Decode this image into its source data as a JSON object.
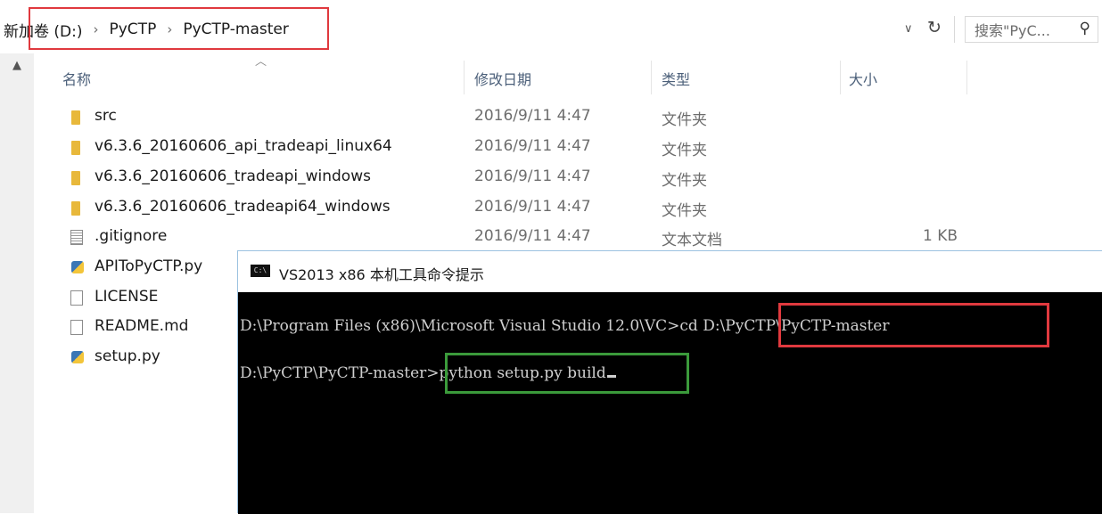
{
  "address_bar": {
    "crumbs": [
      "新加卷 (D:)",
      "PyCTP",
      "PyCTP-master"
    ],
    "separator": "›",
    "search_placeholder": "搜索\"PyC...",
    "refresh_glyph": "↻",
    "dropdown_glyph": "∨",
    "search_glyph": "⚲"
  },
  "columns": {
    "name": "名称",
    "modified": "修改日期",
    "type": "类型",
    "size": "大小"
  },
  "files": [
    {
      "name": "src",
      "modified": "2016/9/11 4:47",
      "type": "文件夹",
      "size": "",
      "icon": "folder-icon"
    },
    {
      "name": "v6.3.6_20160606_api_tradeapi_linux64",
      "modified": "2016/9/11 4:47",
      "type": "文件夹",
      "size": "",
      "icon": "folder-icon"
    },
    {
      "name": "v6.3.6_20160606_tradeapi_windows",
      "modified": "2016/9/11 4:47",
      "type": "文件夹",
      "size": "",
      "icon": "folder-icon"
    },
    {
      "name": "v6.3.6_20160606_tradeapi64_windows",
      "modified": "2016/9/11 4:47",
      "type": "文件夹",
      "size": "",
      "icon": "folder-icon"
    },
    {
      "name": ".gitignore",
      "modified": "2016/9/11 4:47",
      "type": "文本文档",
      "size": "1 KB",
      "icon": "text-file-icon"
    },
    {
      "name": "APIToPyCTP.py",
      "modified": "",
      "type": "",
      "size": "",
      "icon": "python-file-icon"
    },
    {
      "name": "LICENSE",
      "modified": "",
      "type": "",
      "size": "",
      "icon": "file-icon"
    },
    {
      "name": "README.md",
      "modified": "",
      "type": "",
      "size": "",
      "icon": "file-icon"
    },
    {
      "name": "setup.py",
      "modified": "",
      "type": "",
      "size": "",
      "icon": "python-file-icon"
    }
  ],
  "cmd_window": {
    "icon_text": "C:\\",
    "title": "VS2013 x86 本机工具命令提示",
    "line1_prompt": "D:\\Program Files (x86)\\Microsoft Visual Studio 12.0\\VC>",
    "line1_command": "cd D:\\PyCTP\\PyCTP-master",
    "line2_prompt": "D:\\PyCTP\\PyCTP-master>",
    "line2_command": "python setup.py build"
  },
  "colors": {
    "highlight_red": "#e0393e",
    "highlight_green": "#3b9a3b",
    "folder": "#e8b83b",
    "console_bg": "#000000",
    "console_text": "#cfcfcf"
  }
}
